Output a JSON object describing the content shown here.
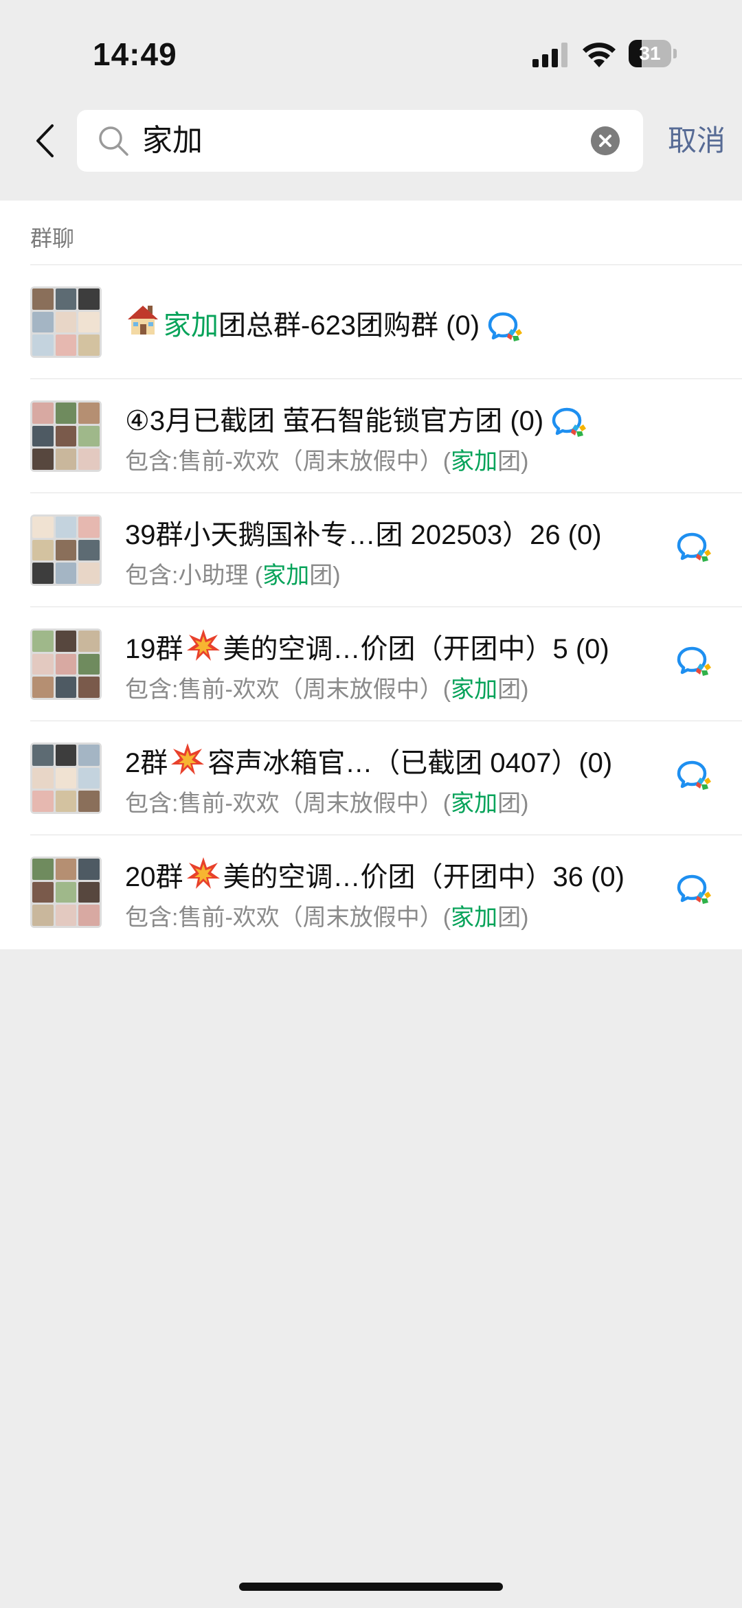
{
  "status_bar": {
    "time": "14:49",
    "battery": "31",
    "battery_level": 0.31
  },
  "search": {
    "query": "家加",
    "cancel_label": "取消"
  },
  "section": {
    "title": "群聊"
  },
  "results": [
    {
      "title_prefix_icon": "house-emoji",
      "title_parts": [
        {
          "t": "家加",
          "hl": true
        },
        {
          "t": "团总群-623团购群 (0)",
          "hl": false
        }
      ],
      "subtitle_parts": [],
      "chat_icon_inline": true
    },
    {
      "title_parts": [
        {
          "t": "④3月已截团 萤石智能锁官方团 (0)",
          "hl": false
        }
      ],
      "subtitle_parts": [
        {
          "t": "包含:售前-欢欢（周末放假中）(",
          "hl": false
        },
        {
          "t": "家加",
          "hl": true
        },
        {
          "t": "团)",
          "hl": false
        }
      ],
      "chat_icon_inline": true
    },
    {
      "title_parts": [
        {
          "t": "39群小天鹅国补专…团 202503）26 (0)",
          "hl": false
        }
      ],
      "subtitle_parts": [
        {
          "t": "包含:小助理 (",
          "hl": false
        },
        {
          "t": "家加",
          "hl": true
        },
        {
          "t": "团)",
          "hl": false
        }
      ],
      "chat_icon_inline": false
    },
    {
      "title_parts": [
        {
          "t": "19群",
          "hl": false
        },
        {
          "t": "[boom]",
          "hl": false
        },
        {
          "t": "美的空调…价团（开团中）5 (0)",
          "hl": false
        }
      ],
      "subtitle_parts": [
        {
          "t": "包含:售前-欢欢（周末放假中）(",
          "hl": false
        },
        {
          "t": "家加",
          "hl": true
        },
        {
          "t": "团)",
          "hl": false
        }
      ],
      "chat_icon_inline": false
    },
    {
      "title_parts": [
        {
          "t": "2群",
          "hl": false
        },
        {
          "t": "[boom]",
          "hl": false
        },
        {
          "t": "容声冰箱官…（已截团 0407）(0)",
          "hl": false
        }
      ],
      "subtitle_parts": [
        {
          "t": "包含:售前-欢欢（周末放假中）(",
          "hl": false
        },
        {
          "t": "家加",
          "hl": true
        },
        {
          "t": "团)",
          "hl": false
        }
      ],
      "chat_icon_inline": false
    },
    {
      "title_parts": [
        {
          "t": "20群",
          "hl": false
        },
        {
          "t": "[boom]",
          "hl": false
        },
        {
          "t": "美的空调…价团（开团中）36 (0)",
          "hl": false
        }
      ],
      "subtitle_parts": [
        {
          "t": "包含:售前-欢欢（周末放假中）(",
          "hl": false
        },
        {
          "t": "家加",
          "hl": true
        },
        {
          "t": "团)",
          "hl": false
        }
      ],
      "chat_icon_inline": false
    }
  ],
  "colors": {
    "highlight": "#07a35a",
    "link": "#576b95",
    "background": "#ededed"
  }
}
